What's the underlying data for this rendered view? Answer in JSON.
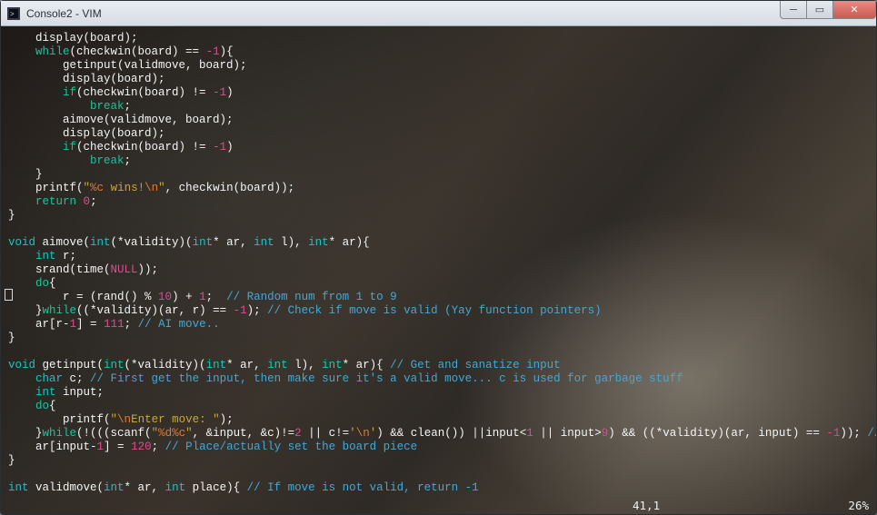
{
  "window": {
    "title": "Console2 - VIM",
    "icon_name": "console2-icon"
  },
  "controls": {
    "minimize_label": "─",
    "maximize_label": "▭",
    "close_label": "✕"
  },
  "status": {
    "position": "41,1",
    "percent": "26%"
  },
  "code": {
    "lines": [
      {
        "indent": 4,
        "tokens": [
          [
            "id",
            "display"
          ],
          [
            "id",
            "(board);"
          ]
        ]
      },
      {
        "indent": 4,
        "tokens": [
          [
            "k",
            "while"
          ],
          [
            "id",
            "(checkwin(board) == "
          ],
          [
            "n",
            "-1"
          ],
          [
            "id",
            "){"
          ]
        ]
      },
      {
        "indent": 8,
        "tokens": [
          [
            "id",
            "getinput(validmove, board);"
          ]
        ]
      },
      {
        "indent": 8,
        "tokens": [
          [
            "id",
            "display(board);"
          ]
        ]
      },
      {
        "indent": 8,
        "tokens": [
          [
            "k",
            "if"
          ],
          [
            "id",
            "(checkwin(board) != "
          ],
          [
            "n",
            "-1"
          ],
          [
            "id",
            ")"
          ]
        ]
      },
      {
        "indent": 12,
        "tokens": [
          [
            "k",
            "break"
          ],
          [
            "id",
            ";"
          ]
        ]
      },
      {
        "indent": 8,
        "tokens": [
          [
            "id",
            "aimove(validmove, board);"
          ]
        ]
      },
      {
        "indent": 8,
        "tokens": [
          [
            "id",
            "display(board);"
          ]
        ]
      },
      {
        "indent": 8,
        "tokens": [
          [
            "k",
            "if"
          ],
          [
            "id",
            "(checkwin(board) != "
          ],
          [
            "n",
            "-1"
          ],
          [
            "id",
            ")"
          ]
        ]
      },
      {
        "indent": 12,
        "tokens": [
          [
            "k",
            "break"
          ],
          [
            "id",
            ";"
          ]
        ]
      },
      {
        "indent": 4,
        "tokens": [
          [
            "id",
            "}"
          ]
        ]
      },
      {
        "indent": 4,
        "tokens": [
          [
            "id",
            "printf("
          ],
          [
            "s",
            "\""
          ],
          [
            "e",
            "%c"
          ],
          [
            "s",
            " wins!"
          ],
          [
            "e",
            "\\n"
          ],
          [
            "s",
            "\""
          ],
          [
            "id",
            ", checkwin(board));"
          ]
        ]
      },
      {
        "indent": 4,
        "tokens": [
          [
            "k",
            "return"
          ],
          [
            "id",
            " "
          ],
          [
            "n",
            "0"
          ],
          [
            "id",
            ";"
          ]
        ]
      },
      {
        "indent": 0,
        "tokens": [
          [
            "id",
            "}"
          ]
        ]
      },
      {
        "indent": 0,
        "tokens": []
      },
      {
        "indent": 0,
        "tokens": [
          [
            "t",
            "void"
          ],
          [
            "id",
            " aimove("
          ],
          [
            "t",
            "int"
          ],
          [
            "id",
            "(*validity)("
          ],
          [
            "t",
            "int"
          ],
          [
            "id",
            "* ar, "
          ],
          [
            "t",
            "int"
          ],
          [
            "id",
            " l), "
          ],
          [
            "t",
            "int"
          ],
          [
            "id",
            "* ar){"
          ]
        ]
      },
      {
        "indent": 4,
        "tokens": [
          [
            "t",
            "int"
          ],
          [
            "id",
            " r;"
          ]
        ]
      },
      {
        "indent": 4,
        "tokens": [
          [
            "id",
            "srand(time("
          ],
          [
            "n",
            "NULL"
          ],
          [
            "id",
            "));"
          ]
        ]
      },
      {
        "indent": 4,
        "tokens": [
          [
            "k",
            "do"
          ],
          [
            "id",
            "{"
          ]
        ]
      },
      {
        "indent": 8,
        "tokens": [
          [
            "id",
            "r = (rand() % "
          ],
          [
            "n",
            "10"
          ],
          [
            "id",
            ") + "
          ],
          [
            "n",
            "1"
          ],
          [
            "id",
            ";  "
          ],
          [
            "c",
            "// Random num from 1 to 9"
          ]
        ]
      },
      {
        "indent": 4,
        "tokens": [
          [
            "id",
            "}"
          ],
          [
            "k",
            "while"
          ],
          [
            "id",
            "((*validity)(ar, r) == "
          ],
          [
            "n",
            "-1"
          ],
          [
            "id",
            "); "
          ],
          [
            "c",
            "// Check if move is valid (Yay function pointers)"
          ]
        ]
      },
      {
        "indent": 4,
        "tokens": [
          [
            "id",
            "ar[r-"
          ],
          [
            "n",
            "1"
          ],
          [
            "id",
            "] = "
          ],
          [
            "n",
            "111"
          ],
          [
            "id",
            "; "
          ],
          [
            "c",
            "// AI move.."
          ]
        ]
      },
      {
        "indent": 0,
        "tokens": [
          [
            "id",
            "}"
          ]
        ]
      },
      {
        "indent": 0,
        "tokens": []
      },
      {
        "indent": 0,
        "tokens": [
          [
            "t",
            "void"
          ],
          [
            "id",
            " getinput("
          ],
          [
            "t",
            "int"
          ],
          [
            "id",
            "(*validity)("
          ],
          [
            "t",
            "int"
          ],
          [
            "id",
            "* ar, "
          ],
          [
            "t",
            "int"
          ],
          [
            "id",
            " l), "
          ],
          [
            "t",
            "int"
          ],
          [
            "id",
            "* ar){ "
          ],
          [
            "c",
            "// Get and sanatize input"
          ]
        ]
      },
      {
        "indent": 4,
        "tokens": [
          [
            "t",
            "char"
          ],
          [
            "id",
            " c; "
          ],
          [
            "c",
            "// First get the input, then make sure it's a valid move... c is used for garbage stuff"
          ]
        ]
      },
      {
        "indent": 4,
        "tokens": [
          [
            "t",
            "int"
          ],
          [
            "id",
            " input;"
          ]
        ]
      },
      {
        "indent": 4,
        "tokens": [
          [
            "k",
            "do"
          ],
          [
            "id",
            "{"
          ]
        ]
      },
      {
        "indent": 8,
        "tokens": [
          [
            "id",
            "printf("
          ],
          [
            "s",
            "\""
          ],
          [
            "e",
            "\\n"
          ],
          [
            "s",
            "Enter move: \""
          ],
          [
            "id",
            ");"
          ]
        ]
      },
      {
        "indent": 4,
        "tokens": [
          [
            "id",
            "}"
          ],
          [
            "k",
            "while"
          ],
          [
            "id",
            "(!(((scanf("
          ],
          [
            "s",
            "\""
          ],
          [
            "e",
            "%d%c"
          ],
          [
            "s",
            "\""
          ],
          [
            "id",
            ", &input, &c)!="
          ],
          [
            "n",
            "2"
          ],
          [
            "id",
            " || c!="
          ],
          [
            "s",
            "'"
          ],
          [
            "e",
            "\\n"
          ],
          [
            "s",
            "'"
          ],
          [
            "id",
            ") && clean()) ||input<"
          ],
          [
            "n",
            "1"
          ],
          [
            "id",
            " || input>"
          ],
          [
            "n",
            "9"
          ],
          [
            "id",
            ") && ((*validity)(ar, input) == "
          ],
          [
            "n",
            "-1"
          ],
          [
            "id",
            ")); "
          ],
          [
            "c",
            "// Magic."
          ]
        ]
      },
      {
        "indent": 4,
        "tokens": [
          [
            "id",
            "ar[input-"
          ],
          [
            "n",
            "1"
          ],
          [
            "id",
            "] = "
          ],
          [
            "n",
            "120"
          ],
          [
            "id",
            "; "
          ],
          [
            "c",
            "// Place/actually set the board piece"
          ]
        ]
      },
      {
        "indent": 0,
        "tokens": [
          [
            "id",
            "}"
          ]
        ]
      },
      {
        "indent": 0,
        "tokens": []
      },
      {
        "indent": 0,
        "tokens": [
          [
            "t",
            "int"
          ],
          [
            "id",
            " validmove("
          ],
          [
            "t",
            "int"
          ],
          [
            "id",
            "* ar, "
          ],
          [
            "t",
            "int"
          ],
          [
            "id",
            " place){ "
          ],
          [
            "c",
            "// If move is not valid, return -1"
          ]
        ]
      }
    ]
  }
}
